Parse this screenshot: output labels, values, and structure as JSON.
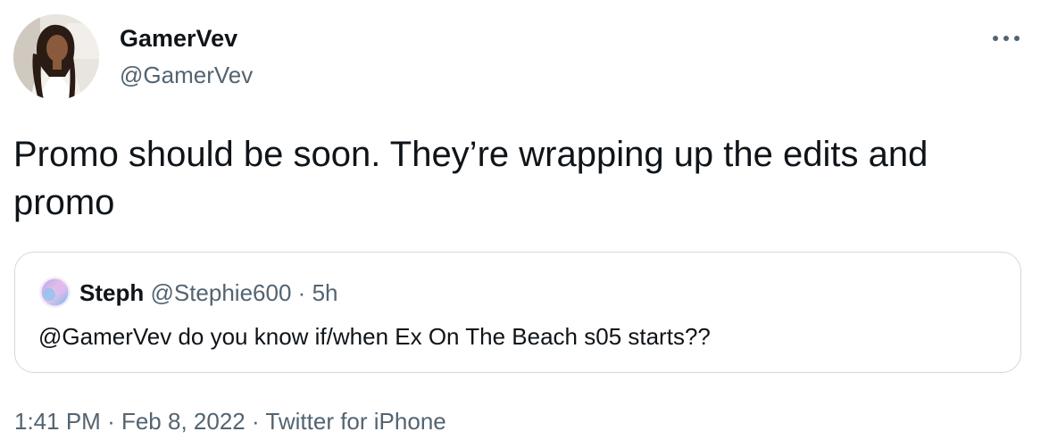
{
  "author": {
    "display_name": "GamerVev",
    "handle": "@GamerVev"
  },
  "tweet": {
    "text": "Promo should be soon. They’re wrapping up the edits and promo"
  },
  "more_menu": {
    "icon": "more-horizontal-icon"
  },
  "quoted_tweet": {
    "display_name": "Steph",
    "handle": "@Stephie600",
    "separator": "·",
    "age": "5h",
    "text": "@GamerVev do you know if/when Ex On The Beach s05 starts??"
  },
  "meta": {
    "time": "1:41 PM",
    "separator": "·",
    "date": "Feb 8, 2022",
    "client": "Twitter for iPhone"
  },
  "colors": {
    "text_primary": "#0f1419",
    "text_secondary": "#536471",
    "border": "#cfd9de"
  }
}
